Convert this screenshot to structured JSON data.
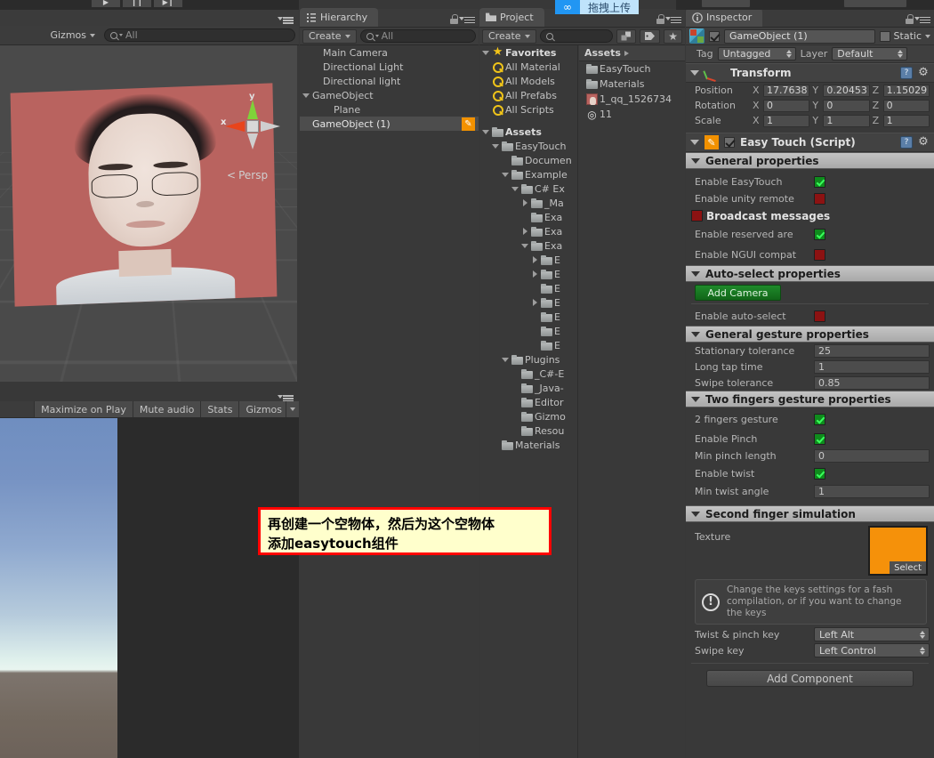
{
  "upload_overlay": {
    "logo": "∞",
    "label": "拖拽上传"
  },
  "scene_view": {
    "gizmos_label": "Gizmos",
    "search_placeholder": "All",
    "axis_y": "y",
    "axis_x": "x",
    "perspective_label": "Persp"
  },
  "game_view": {
    "buttons": [
      "Maximize on Play",
      "Mute audio",
      "Stats",
      "Gizmos"
    ]
  },
  "hierarchy": {
    "tab_title": "Hierarchy",
    "create_label": "Create",
    "search_placeholder": "All",
    "items": [
      {
        "label": "Main Camera",
        "indent": 1,
        "arrow": "none",
        "selected": false,
        "badge": false
      },
      {
        "label": "Directional Light",
        "indent": 1,
        "arrow": "none",
        "selected": false,
        "badge": false
      },
      {
        "label": "Directional light",
        "indent": 1,
        "arrow": "none",
        "selected": false,
        "badge": false
      },
      {
        "label": "GameObject",
        "indent": 0,
        "arrow": "open",
        "selected": false,
        "badge": false
      },
      {
        "label": "Plane",
        "indent": 2,
        "arrow": "none",
        "selected": false,
        "badge": false
      },
      {
        "label": "GameObject (1)",
        "indent": 0,
        "arrow": "none",
        "selected": true,
        "badge": true
      }
    ]
  },
  "project": {
    "tab_title": "Project",
    "create_label": "Create",
    "search_placeholder": "",
    "favorites_label": "Favorites",
    "assets_label": "Assets",
    "breadcrumb": "Assets",
    "favorites": [
      {
        "label": "All Material",
        "icon": "search-icon"
      },
      {
        "label": "All Models",
        "icon": "search-icon"
      },
      {
        "label": "All Prefabs",
        "icon": "search-icon"
      },
      {
        "label": "All Scripts",
        "icon": "search-icon"
      }
    ],
    "tree": [
      {
        "label": "Assets",
        "indent": 0,
        "arrow": "open",
        "bold": true
      },
      {
        "label": "EasyTouch",
        "indent": 1,
        "arrow": "open",
        "bold": false
      },
      {
        "label": "Documen",
        "indent": 2,
        "arrow": "none",
        "bold": false
      },
      {
        "label": "Example",
        "indent": 2,
        "arrow": "open",
        "bold": false
      },
      {
        "label": "C# Ex",
        "indent": 3,
        "arrow": "open",
        "bold": false
      },
      {
        "label": "_Ma",
        "indent": 4,
        "arrow": "closed",
        "bold": false
      },
      {
        "label": "Exa",
        "indent": 4,
        "arrow": "none",
        "bold": false
      },
      {
        "label": "Exa",
        "indent": 4,
        "arrow": "closed",
        "bold": false
      },
      {
        "label": "Exa",
        "indent": 4,
        "arrow": "open",
        "bold": false
      },
      {
        "label": "E",
        "indent": 5,
        "arrow": "closed",
        "bold": false
      },
      {
        "label": "E",
        "indent": 5,
        "arrow": "closed",
        "bold": false
      },
      {
        "label": "E",
        "indent": 5,
        "arrow": "none",
        "bold": false
      },
      {
        "label": "E",
        "indent": 5,
        "arrow": "closed",
        "bold": false
      },
      {
        "label": "E",
        "indent": 5,
        "arrow": "none",
        "bold": false
      },
      {
        "label": "E",
        "indent": 5,
        "arrow": "none",
        "bold": false
      },
      {
        "label": "E",
        "indent": 5,
        "arrow": "none",
        "bold": false
      },
      {
        "label": "Plugins",
        "indent": 2,
        "arrow": "open",
        "bold": false
      },
      {
        "label": "_C#-E",
        "indent": 3,
        "arrow": "none",
        "bold": false
      },
      {
        "label": "_Java-",
        "indent": 3,
        "arrow": "none",
        "bold": false
      },
      {
        "label": "Editor",
        "indent": 3,
        "arrow": "none",
        "bold": false
      },
      {
        "label": "Gizmo",
        "indent": 3,
        "arrow": "none",
        "bold": false
      },
      {
        "label": "Resou",
        "indent": 3,
        "arrow": "none",
        "bold": false
      },
      {
        "label": "Materials",
        "indent": 1,
        "arrow": "none",
        "bold": false
      }
    ],
    "assets": [
      {
        "label": "EasyTouch",
        "icon": "folder-icon"
      },
      {
        "label": "Materials",
        "icon": "folder-icon"
      },
      {
        "label": "1_qq_1526734",
        "icon": "image-thumbnail"
      },
      {
        "label": "11",
        "icon": "unity-scene-icon"
      }
    ]
  },
  "inspector": {
    "tab_title": "Inspector",
    "object_name": "GameObject (1)",
    "static_label": "Static",
    "tag_label": "Tag",
    "tag_value": "Untagged",
    "layer_label": "Layer",
    "layer_value": "Default",
    "transform": {
      "title": "Transform",
      "rows": [
        {
          "label": "Position",
          "x": "17.7638",
          "y": "0.20453",
          "z": "1.15029"
        },
        {
          "label": "Rotation",
          "x": "0",
          "y": "0",
          "z": "0"
        },
        {
          "label": "Scale",
          "x": "1",
          "y": "1",
          "z": "1"
        }
      ]
    },
    "easytouch": {
      "title": "Easy Touch (Script)",
      "general_section": "General properties",
      "general_rows": [
        {
          "label": "Enable EasyTouch",
          "state": "on"
        },
        {
          "label": "Enable unity remote",
          "state": "off"
        }
      ],
      "broadcast_label": "Broadcast messages",
      "broadcast_state": "off",
      "reserved_label": "Enable reserved are",
      "reserved_state": "on",
      "ngui_label": "Enable NGUI compat",
      "ngui_state": "off",
      "autoselect_section": "Auto-select properties",
      "add_camera_label": "Add Camera",
      "autoselect_label": "Enable auto-select",
      "autoselect_state": "off",
      "gesture_section": "General gesture properties",
      "gesture_fields": [
        {
          "label": "Stationary tolerance",
          "value": "25"
        },
        {
          "label": "Long tap time",
          "value": "1"
        },
        {
          "label": "Swipe tolerance",
          "value": "0.85"
        }
      ],
      "twofinger_section": "Two fingers gesture properties",
      "twofinger_toggle": {
        "label": "2 fingers gesture",
        "state": "on"
      },
      "pinch_toggle": {
        "label": "Enable Pinch",
        "state": "on"
      },
      "pinch_field": {
        "label": "Min pinch length",
        "value": "0"
      },
      "twist_toggle": {
        "label": "Enable twist",
        "state": "on"
      },
      "twist_field": {
        "label": "Min twist angle",
        "value": "1"
      },
      "secondfinger_section": "Second finger simulation",
      "texture_label": "Texture",
      "texture_select_label": "Select",
      "texture_color": "#f5910a",
      "help_text": "Change the keys settings for a fash compilation, or if you want to change the keys",
      "key_rows": [
        {
          "label": "Twist & pinch key",
          "value": "Left Alt"
        },
        {
          "label": "Swipe key",
          "value": "Left Control"
        }
      ]
    },
    "add_component_label": "Add Component"
  },
  "annotation": {
    "line1": "再创建一个空物体，然后为这个空物体",
    "line2": "添加easytouch组件",
    "border_color": "#ff0000",
    "background_color": "#ffffcc"
  }
}
